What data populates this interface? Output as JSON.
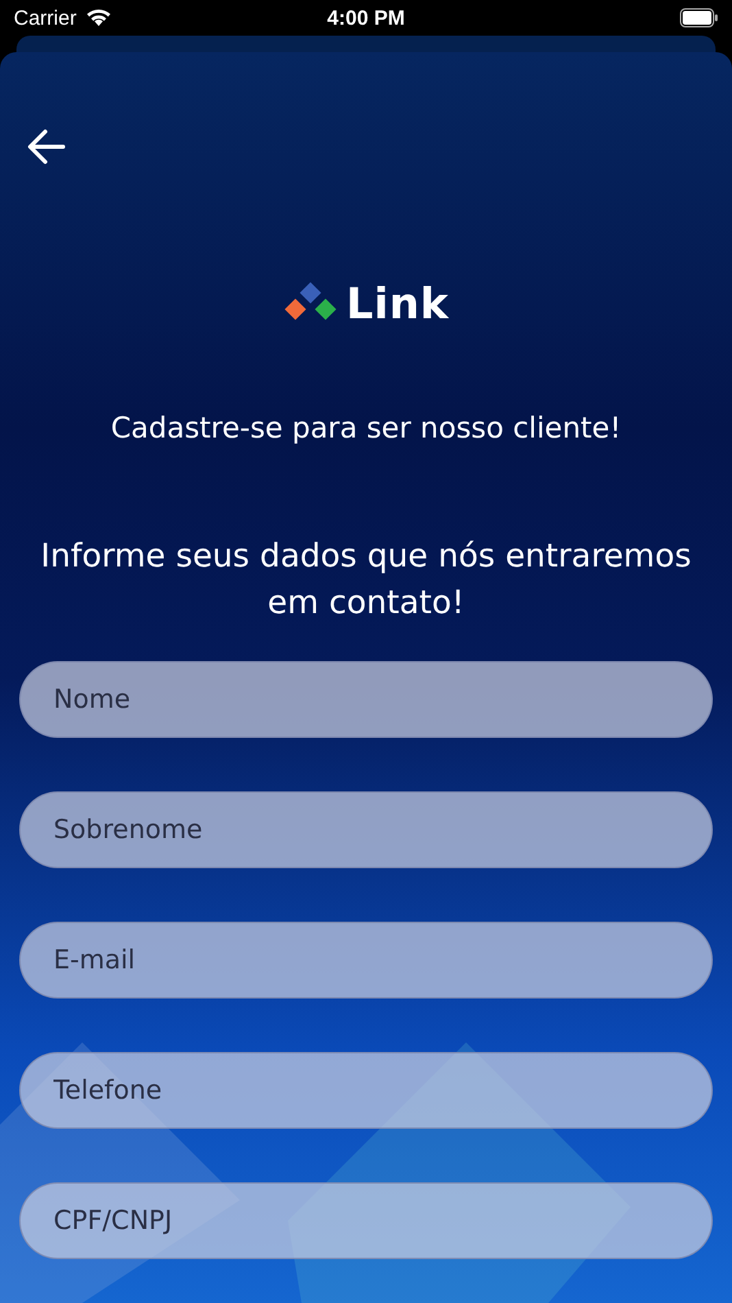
{
  "status_bar": {
    "carrier": "Carrier",
    "time": "4:00 PM"
  },
  "logo": {
    "wordmark": "Link"
  },
  "subtitle": "Cadastre-se para ser nosso cliente!",
  "heading": "Informe seus dados que nós entraremos em contato!",
  "fields": [
    {
      "placeholder": "Nome"
    },
    {
      "placeholder": "Sobrenome"
    },
    {
      "placeholder": "E-mail"
    },
    {
      "placeholder": "Telefone"
    },
    {
      "placeholder": "CPF/CNPJ"
    }
  ]
}
